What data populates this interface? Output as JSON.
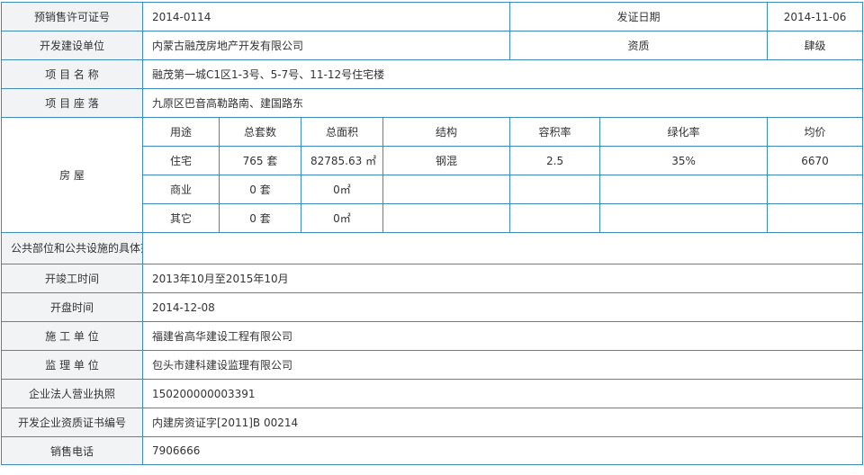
{
  "permit": {
    "label": "预销售许可证号",
    "value": "2014-0114",
    "date_label": "发证日期",
    "date_value": "2014-11-06"
  },
  "developer": {
    "label": "开发建设单位",
    "value": "内蒙古融茂房地产开发有限公司",
    "qual_label": "资质",
    "qual_value": "肆级"
  },
  "project_name": {
    "label": "项 目 名 称",
    "value": "融茂第一城C1区1-3号、5-7号、11-12号住宅楼"
  },
  "project_location": {
    "label": "项 目 座 落",
    "value": "九原区巴音高勒路南、建国路东"
  },
  "housing": {
    "label": "房 屋",
    "headers": [
      "用途",
      "总套数",
      "总面积",
      "结构",
      "容积率",
      "绿化率",
      "均价"
    ],
    "rows": [
      [
        "住宅",
        "765 套",
        "82785.63 ㎡",
        "钢混",
        "2.5",
        "35%",
        "6670"
      ],
      [
        "商业",
        "0 套",
        "0㎡",
        "",
        "",
        "",
        ""
      ],
      [
        "其它",
        "0 套",
        "0㎡",
        "",
        "",
        "",
        ""
      ]
    ]
  },
  "public_scope": {
    "label": "公共部位和公共设施的具体范围",
    "value": ""
  },
  "construction_time": {
    "label": "开竣工时间",
    "value": "2013年10月至2015年10月"
  },
  "opening_time": {
    "label": "开盘时间",
    "value": "2014-12-08"
  },
  "contractor": {
    "label": "施 工 单 位",
    "value": "福建省高华建设工程有限公司"
  },
  "supervisor": {
    "label": "监 理 单 位",
    "value": "包头市建科建设监理有限公司"
  },
  "license": {
    "label": "企业法人营业执照",
    "value": "150200000003391"
  },
  "qual_cert": {
    "label": "开发企业资质证书编号",
    "value": "内建房资证字[2011]B 00214"
  },
  "phone": {
    "label": "销售电话",
    "value": "7906666"
  }
}
